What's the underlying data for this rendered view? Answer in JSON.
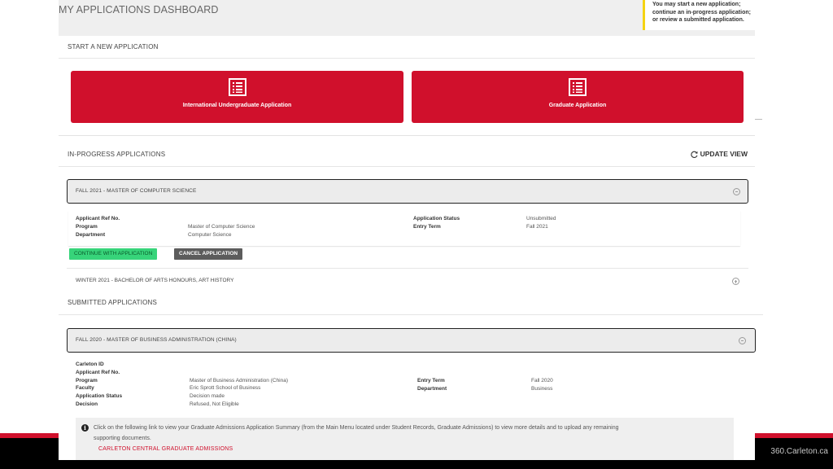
{
  "header": {
    "title": "MY APPLICATIONS DASHBOARD",
    "notice": [
      "You may start a new application;",
      "continue an in-progress application;",
      "or review a submitted application."
    ]
  },
  "start_section": {
    "label": "START A NEW APPLICATION",
    "buttons": [
      {
        "label": "International Undergraduate Application",
        "icon": "document-list-icon"
      },
      {
        "label": "Graduate Application",
        "icon": "document-list-icon"
      }
    ]
  },
  "in_progress": {
    "label": "IN-PROGRESS APPLICATIONS",
    "update_label": "UPDATE VIEW",
    "update_icon": "refresh-icon",
    "apps": [
      {
        "title": "FALL 2021 - MASTER OF COMPUTER SCIENCE",
        "expanded": true,
        "left_fields": [
          {
            "label": "Applicant Ref No.",
            "value": ""
          },
          {
            "label": "Program",
            "value": "Master of Computer Science"
          },
          {
            "label": "Department",
            "value": "Computer Science"
          }
        ],
        "right_fields": [
          {
            "label": "Application Status",
            "value": "Unsubmitted"
          },
          {
            "label": "Entry Term",
            "value": "Fall 2021"
          }
        ],
        "continue_label": "CONTINUE WITH APPLICATION",
        "cancel_label": "CANCEL APPLICATION"
      },
      {
        "title": "WINTER 2021 - BACHELOR OF ARTS HONOURS, ART HISTORY",
        "expanded": false
      }
    ]
  },
  "submitted": {
    "label": "SUBMITTED APPLICATIONS",
    "apps": [
      {
        "title": "FALL 2020 - MASTER OF BUSINESS ADMINISTRATION (CHINA)",
        "left_fields": [
          {
            "label": "Carleton ID",
            "value": ""
          },
          {
            "label": "Applicant Ref No.",
            "value": ""
          },
          {
            "label": "Program",
            "value": "Master of Business Administration (China)"
          },
          {
            "label": "Faculty",
            "value": "Eric Sprott School of Business"
          },
          {
            "label": "Application Status",
            "value": "Decision made"
          },
          {
            "label": "Decision",
            "value": "Refused, Not Eligible"
          }
        ],
        "right_fields": [
          {
            "label": "Entry Term",
            "value": "Fall 2020"
          },
          {
            "label": "Department",
            "value": "Business"
          }
        ],
        "info_line1": "Click on the following link to view your Graduate Admissions Application Summary (from the Main Menu located under Student Records, Graduate Admissions) to view more details and to upload any remaining",
        "info_line2": "supporting documents.",
        "link": "CARLETON CENTRAL GRADUATE ADMISSIONS"
      }
    ]
  },
  "footer": {
    "link": "360.Carleton.ca"
  },
  "colors": {
    "brand_red": "#d0102c",
    "continue_green": "#37d47a",
    "cancel_gray": "#5c5c5c",
    "notice_yellow": "#f5d312"
  }
}
